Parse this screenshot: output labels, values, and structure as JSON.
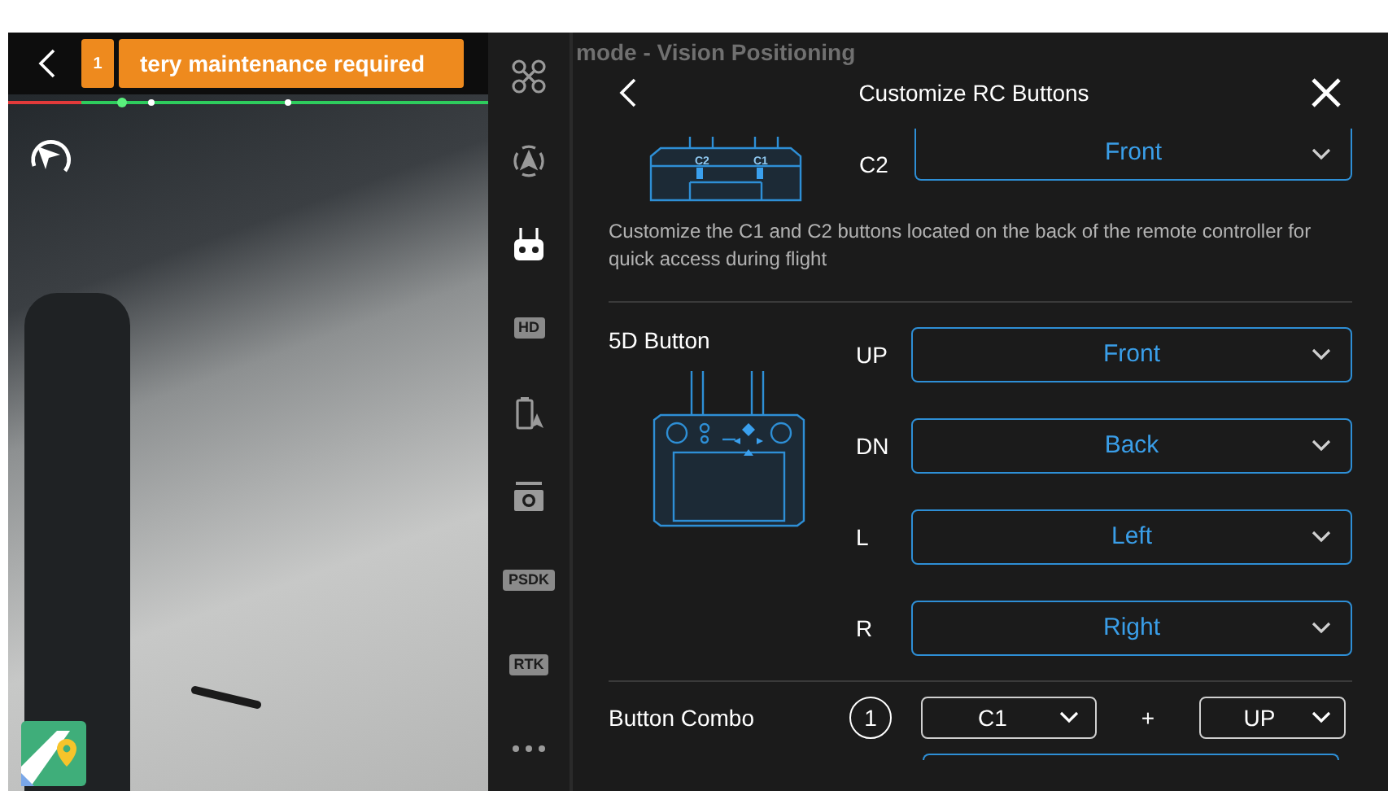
{
  "alert": {
    "count": "1",
    "message": "tery maintenance required"
  },
  "status": {
    "mode": "mode - Vision Positioning"
  },
  "rail": [
    {
      "kind": "drone"
    },
    {
      "kind": "compass"
    },
    {
      "kind": "remote",
      "selected": true
    },
    {
      "kind": "tag",
      "text": "HD",
      "selected": false
    },
    {
      "kind": "battery",
      "selected": false
    },
    {
      "kind": "camera",
      "selected": false
    },
    {
      "kind": "tag",
      "text": "PSDK",
      "selected": false
    },
    {
      "kind": "tag",
      "text": "RTK",
      "selected": false
    },
    {
      "kind": "more",
      "selected": false
    }
  ],
  "panel": {
    "title": "Customize RC Buttons",
    "c_buttons": {
      "marks": [
        "C2",
        "C1"
      ],
      "label": "C2",
      "value": "Front",
      "description": "Customize the C1 and C2 buttons located on the back of the remote controller for quick access during flight"
    },
    "five_d": {
      "title": "5D Button",
      "rows": [
        {
          "label": "UP",
          "value": "Front"
        },
        {
          "label": "DN",
          "value": "Back"
        },
        {
          "label": "L",
          "value": "Left"
        },
        {
          "label": "R",
          "value": "Right"
        }
      ]
    },
    "combo": {
      "title": "Button Combo",
      "number": "1",
      "first": "C1",
      "plus": "+",
      "second": "UP"
    }
  }
}
